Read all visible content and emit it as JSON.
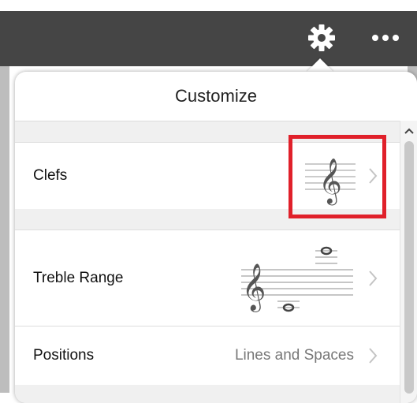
{
  "topbar": {
    "icons": [
      "gear-icon",
      "more-icon"
    ],
    "bar_color": "#454545"
  },
  "popover": {
    "title": "Customize",
    "rows": [
      {
        "label": "Clefs",
        "value": "",
        "preview": "treble-clef-staff"
      },
      {
        "label": "Treble Range",
        "value": "",
        "preview": "treble-range-staff"
      },
      {
        "label": "Positions",
        "value": "Lines and Spaces"
      }
    ]
  },
  "highlight_color": "#e0202a"
}
